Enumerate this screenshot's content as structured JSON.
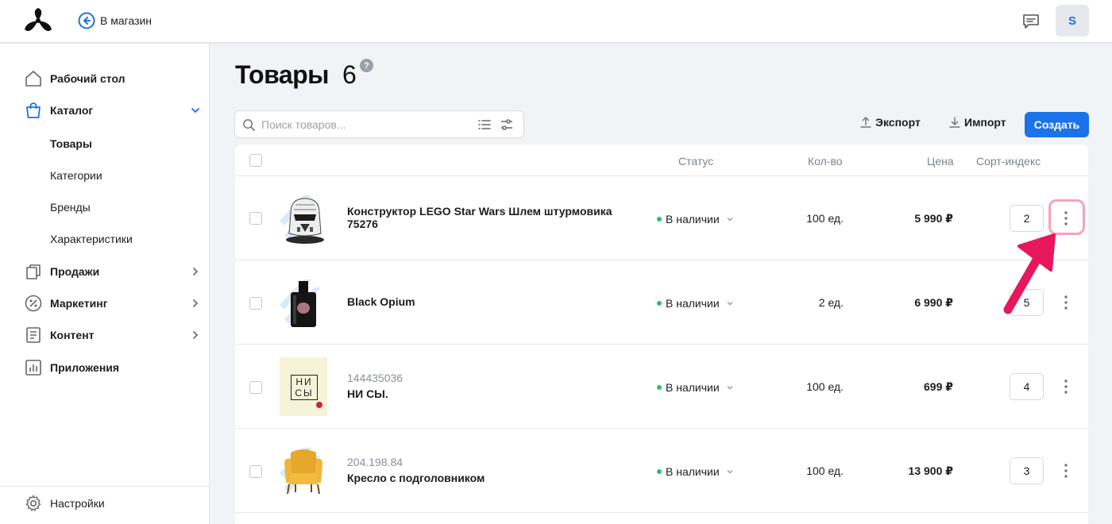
{
  "topbar": {
    "store_link": "В магазин",
    "avatar_letter": "S"
  },
  "sidebar": {
    "items": [
      {
        "label": "Рабочий стол",
        "icon": "home-icon"
      },
      {
        "label": "Каталог",
        "icon": "shopping-bag-icon"
      },
      {
        "label": "Продажи",
        "icon": "sales-icon"
      },
      {
        "label": "Маркетинг",
        "icon": "percent-icon"
      },
      {
        "label": "Контент",
        "icon": "document-icon"
      },
      {
        "label": "Приложения",
        "icon": "bar-chart-icon"
      }
    ],
    "catalog_sub": [
      "Товары",
      "Категории",
      "Бренды",
      "Характеристики"
    ],
    "settings": "Настройки"
  },
  "header": {
    "title": "Товары",
    "count": "6",
    "help": "?"
  },
  "toolbar": {
    "search_placeholder": "Поиск товаров...",
    "export_label": "Экспорт",
    "import_label": "Импорт",
    "create_label": "Создать"
  },
  "table": {
    "columns": {
      "status": "Статус",
      "qty": "Кол-во",
      "price": "Цена",
      "sort": "Сорт-индекс"
    },
    "rows": [
      {
        "code": "",
        "name": "Конструктор LEGO Star Wars Шлем штурмовика 75276",
        "status": "В наличии",
        "qty": "100 ед.",
        "price": "5 990 ₽",
        "sort": "2",
        "thumb": "helmet"
      },
      {
        "code": "",
        "name": "Black Opium",
        "status": "В наличии",
        "qty": "2 ед.",
        "price": "6 990 ₽",
        "sort": "5",
        "thumb": "perfume"
      },
      {
        "code": "144435036",
        "name": "НИ СЫ.",
        "status": "В наличии",
        "qty": "100 ед.",
        "price": "699 ₽",
        "sort": "4",
        "thumb": "book"
      },
      {
        "code": "204.198.84",
        "name": "Кресло с подголовником",
        "status": "В наличии",
        "qty": "100 ед.",
        "price": "13 900 ₽",
        "sort": "3",
        "thumb": "chair"
      }
    ]
  },
  "book_cover": {
    "line1": "НИ",
    "line2": "СЫ"
  },
  "colors": {
    "accent": "#1a73e8",
    "in_stock": "#2ebd6b",
    "highlight": "#f5a3b8",
    "arrow": "#e8165a"
  }
}
